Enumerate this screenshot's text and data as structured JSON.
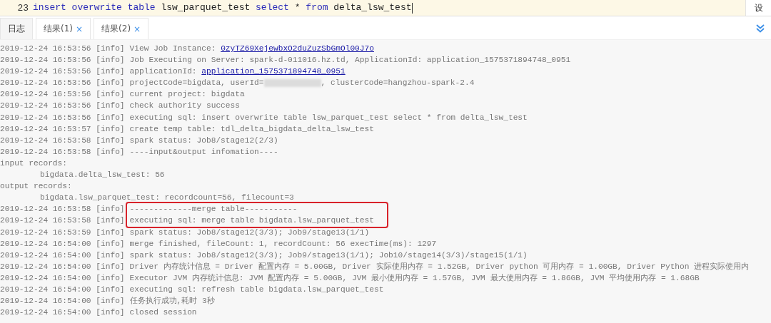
{
  "editor": {
    "line_number": "23",
    "tokens": [
      {
        "kind": "keyword",
        "text": "insert"
      },
      {
        "kind": "keyword",
        "text": "overwrite"
      },
      {
        "kind": "keyword",
        "text": "table"
      },
      {
        "kind": "plain",
        "text": "lsw_parquet_test"
      },
      {
        "kind": "keyword",
        "text": "select"
      },
      {
        "kind": "plain",
        "text": "*"
      },
      {
        "kind": "keyword",
        "text": "from"
      },
      {
        "kind": "plain",
        "text": "delta_lsw_test"
      }
    ],
    "side_button": "设"
  },
  "tabs": [
    {
      "label": "日志",
      "selected": true
    },
    {
      "label": "结果(1)",
      "selected": false,
      "close": "×"
    },
    {
      "label": "结果(2)",
      "selected": false,
      "close": "×"
    }
  ],
  "log": [
    {
      "timestamp": "2019-12-24 16:53:56",
      "level": "[info]",
      "segments": [
        {
          "kind": "text",
          "text": "View Job Instance: "
        },
        {
          "kind": "link",
          "text": "0zyTZ69XejewbxO2duZuzSbGmOl00J7o"
        }
      ]
    },
    {
      "timestamp": "2019-12-24 16:53:56",
      "level": "[info]",
      "segments": [
        {
          "kind": "text",
          "text": "Job Executing on Server: spark-d-011016.hz.td, ApplicationId: application_1575371894748_0951"
        }
      ]
    },
    {
      "timestamp": "2019-12-24 16:53:56",
      "level": "[info]",
      "segments": [
        {
          "kind": "text",
          "text": "applicationId: "
        },
        {
          "kind": "link",
          "text": "application_1575371894748_0951"
        }
      ]
    },
    {
      "timestamp": "2019-12-24 16:53:56",
      "level": "[info]",
      "segments": [
        {
          "kind": "text",
          "text": "projectCode=bigdata, userId="
        },
        {
          "kind": "redacted"
        },
        {
          "kind": "text",
          "text": ", clusterCode=hangzhou-spark-2.4"
        }
      ]
    },
    {
      "timestamp": "2019-12-24 16:53:56",
      "level": "[info]",
      "segments": [
        {
          "kind": "text",
          "text": "current project: bigdata"
        }
      ]
    },
    {
      "timestamp": "2019-12-24 16:53:56",
      "level": "[info]",
      "segments": [
        {
          "kind": "text",
          "text": "check authority success"
        }
      ]
    },
    {
      "timestamp": "2019-12-24 16:53:56",
      "level": "[info]",
      "segments": [
        {
          "kind": "text",
          "text": "executing sql: insert overwrite table lsw_parquet_test select * from delta_lsw_test"
        }
      ]
    },
    {
      "timestamp": "2019-12-24 16:53:57",
      "level": "[info]",
      "segments": [
        {
          "kind": "text",
          "text": "create temp table: tdl_delta_bigdata_delta_lsw_test"
        }
      ]
    },
    {
      "timestamp": "2019-12-24 16:53:58",
      "level": "[info]",
      "segments": [
        {
          "kind": "text",
          "text": "spark status: Job8/stage12(2/3)"
        }
      ]
    },
    {
      "timestamp": "2019-12-24 16:53:58",
      "level": "[info]",
      "segments": [
        {
          "kind": "text",
          "text": "----input&output infomation----"
        }
      ]
    },
    {
      "segments": [
        {
          "kind": "text",
          "text": "input records:"
        }
      ]
    },
    {
      "indented": true,
      "segments": [
        {
          "kind": "text",
          "text": "bigdata.delta_lsw_test: 56"
        }
      ]
    },
    {
      "segments": [
        {
          "kind": "text",
          "text": "output records:"
        }
      ]
    },
    {
      "indented": true,
      "segments": [
        {
          "kind": "text",
          "text": "bigdata.lsw_parquet_test: recordcount=56, filecount=3"
        }
      ]
    },
    {
      "timestamp": "2019-12-24 16:53:58",
      "level": "[info]",
      "highlighted": true,
      "segments": [
        {
          "kind": "text",
          "text": "-------------merge table-----------"
        }
      ]
    },
    {
      "timestamp": "2019-12-24 16:53:58",
      "level": "[info]",
      "highlighted": true,
      "segments": [
        {
          "kind": "text",
          "text": "executing sql: merge table bigdata.lsw_parquet_test"
        }
      ]
    },
    {
      "timestamp": "2019-12-24 16:53:59",
      "level": "[info]",
      "segments": [
        {
          "kind": "text",
          "text": "spark status: Job8/stage12(3/3); Job9/stage13(1/1)"
        }
      ]
    },
    {
      "timestamp": "2019-12-24 16:54:00",
      "level": "[info]",
      "segments": [
        {
          "kind": "text",
          "text": "merge finished, fileCount: 1, recordCount: 56 execTime(ms): 1297"
        }
      ]
    },
    {
      "timestamp": "2019-12-24 16:54:00",
      "level": "[info]",
      "segments": [
        {
          "kind": "text",
          "text": "spark status: Job8/stage12(3/3); Job9/stage13(1/1); Job10/stage14(3/3)/stage15(1/1)"
        }
      ]
    },
    {
      "timestamp": "2019-12-24 16:54:00",
      "level": "[info]",
      "segments": [
        {
          "kind": "text",
          "text": "Driver 内存统计信息 = Driver 配置内存 = 5.00GB, Driver 实际使用内存 = 1.52GB, Driver python 可用内存 = 1.00GB, Driver Python 进程实际使用内"
        }
      ]
    },
    {
      "timestamp": "2019-12-24 16:54:00",
      "level": "[info]",
      "segments": [
        {
          "kind": "text",
          "text": "Executor JVM 内存统计信息: JVM 配置内存 = 5.00GB, JVM 最小使用内存 = 1.57GB, JVM 最大使用内存 = 1.86GB, JVM 平均使用内存 = 1.68GB"
        }
      ]
    },
    {
      "timestamp": "2019-12-24 16:54:00",
      "level": "[info]",
      "segments": [
        {
          "kind": "text",
          "text": "executing sql: refresh table bigdata.lsw_parquet_test"
        }
      ]
    },
    {
      "timestamp": "2019-12-24 16:54:00",
      "level": "[info]",
      "segments": [
        {
          "kind": "text",
          "text": "任务执行成功,耗时 3秒"
        }
      ]
    },
    {
      "timestamp": "2019-12-24 16:54:00",
      "level": "[info]",
      "segments": [
        {
          "kind": "text",
          "text": "closed session"
        }
      ]
    }
  ]
}
